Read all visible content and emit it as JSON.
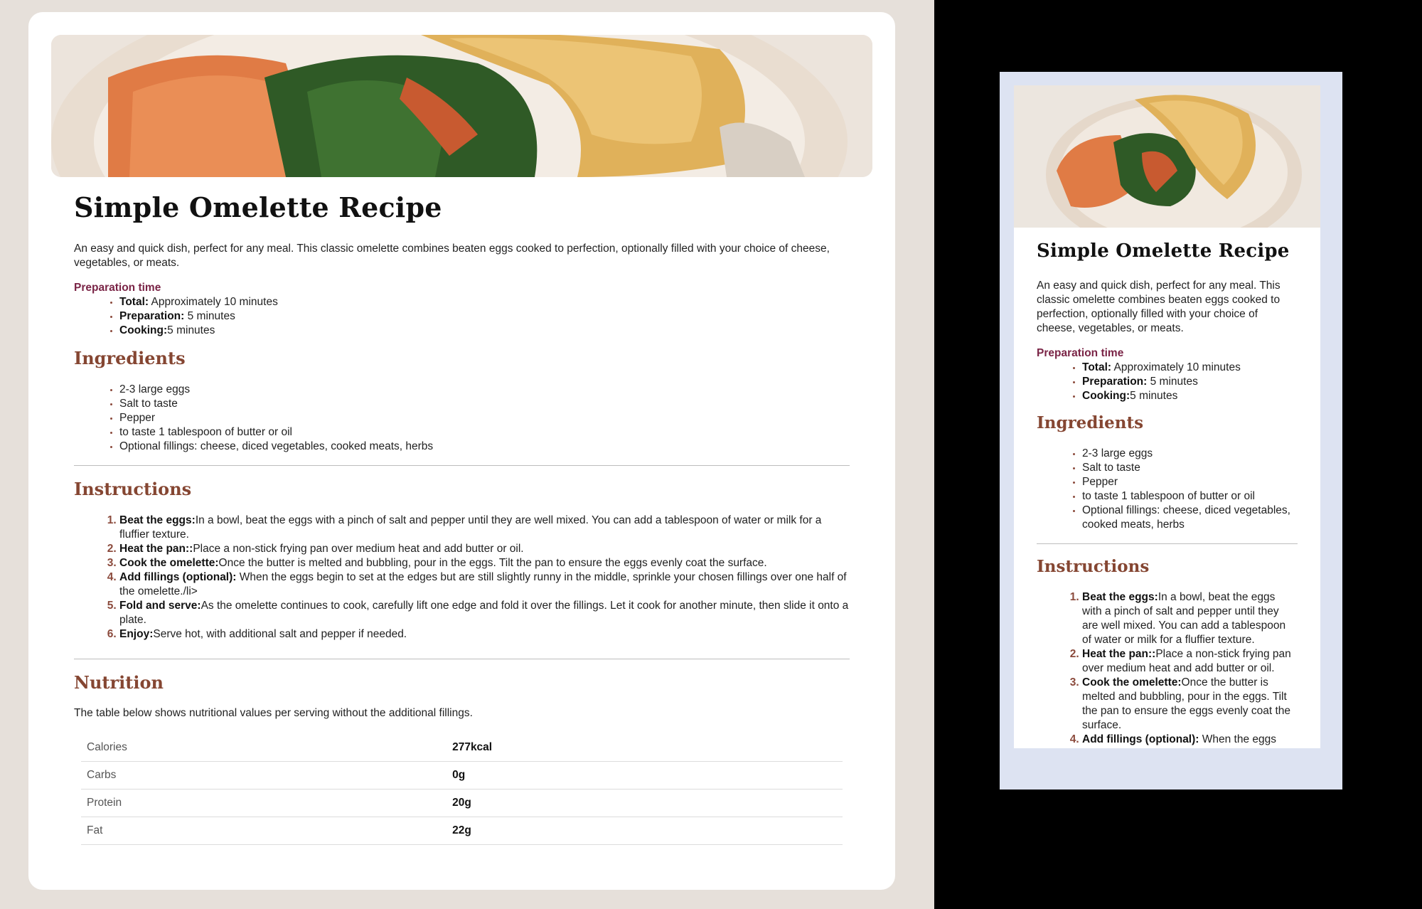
{
  "recipe": {
    "title": "Simple Omelette Recipe",
    "description": "An easy and quick dish, perfect for any meal. This classic omelette combines beaten eggs cooked to perfection, optionally filled with your choice of cheese, vegetables, or meats.",
    "prep": {
      "title": "Preparation time",
      "items": [
        {
          "label": "Total:",
          "value": " Approximately 10 minutes"
        },
        {
          "label": "Preparation:",
          "value": " 5 minutes"
        },
        {
          "label": "Cooking:",
          "value": "5 minutes"
        }
      ]
    },
    "ingredients": {
      "title": "Ingredients",
      "items": [
        "2-3 large eggs",
        "Salt to taste",
        "Pepper",
        "to taste 1 tablespoon of butter or oil",
        "Optional fillings: cheese, diced vegetables, cooked meats, herbs"
      ]
    },
    "instructions": {
      "title": "Instructions",
      "items": [
        {
          "label": "Beat the eggs:",
          "text": "In a bowl, beat the eggs with a pinch of salt and pepper until they are well mixed. You can add a tablespoon of water or milk for a fluffier texture."
        },
        {
          "label": "Heat the pan::",
          "text": "Place a non-stick frying pan over medium heat and add butter or oil."
        },
        {
          "label": "Cook the omelette:",
          "text": "Once the butter is melted and bubbling, pour in the eggs. Tilt the pan to ensure the eggs evenly coat the surface."
        },
        {
          "label": "Add fillings (optional):",
          "text": " When the eggs begin to set at the edges but are still slightly runny in the middle, sprinkle your chosen fillings over one half of the omelette./li>"
        },
        {
          "label": "Fold and serve:",
          "text": "As the omelette continues to cook, carefully lift one edge and fold it over the fillings. Let it cook for another minute, then slide it onto a plate."
        },
        {
          "label": "Enjoy:",
          "text": "Serve hot, with additional salt and pepper if needed."
        }
      ]
    },
    "nutrition": {
      "title": "Nutrition",
      "note": "The table below shows nutritional values per serving without the additional fillings.",
      "rows": [
        {
          "name": "Calories",
          "value": "277kcal"
        },
        {
          "name": "Carbs",
          "value": "0g"
        },
        {
          "name": "Protein",
          "value": "20g"
        },
        {
          "name": "Fat",
          "value": "22g"
        }
      ]
    }
  },
  "colors": {
    "page_bg": "#e6e0da",
    "mobile_bg": "#dde3f2",
    "accent_rose": "#7a2446",
    "accent_brown": "#854632"
  },
  "images": {
    "hero": "omelette-plate-photo"
  }
}
